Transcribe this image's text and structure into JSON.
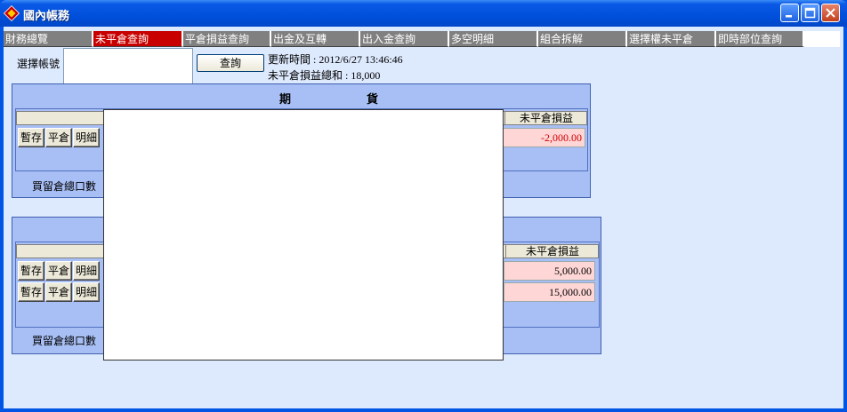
{
  "window": {
    "title": "國內帳務"
  },
  "tabs": [
    {
      "label": "財務總覽",
      "active": false
    },
    {
      "label": "未平倉查詢",
      "active": true
    },
    {
      "label": "平倉損益查詢",
      "active": false
    },
    {
      "label": "出金及互轉",
      "active": false
    },
    {
      "label": "出入金查詢",
      "active": false
    },
    {
      "label": "多空明細",
      "active": false
    },
    {
      "label": "組合拆解",
      "active": false
    },
    {
      "label": "選擇權未平倉",
      "active": false
    },
    {
      "label": "即時部位查詢",
      "active": false
    }
  ],
  "account": {
    "label": "選擇帳號",
    "value": "",
    "query_button": "查詢"
  },
  "status": {
    "updated": "更新時間 : 2012/6/27 13:46:46",
    "total_pl": "未平倉損益總和 : 18,000"
  },
  "futures_panel": {
    "title": "期　　　　　　貨",
    "pl_header": "未平倉損益",
    "row_buttons": [
      "暫存",
      "平倉",
      "明細"
    ],
    "rows": [
      {
        "pl": "-2,000.00"
      }
    ],
    "footer": "買留倉總口數"
  },
  "options_panel": {
    "pl_header": "未平倉損益",
    "row_buttons": [
      "暫存",
      "平倉",
      "明細"
    ],
    "rows": [
      {
        "pl": "5,000.00"
      },
      {
        "pl": "15,000.00"
      }
    ],
    "footer": "買留倉總口數"
  },
  "colors": {
    "active_tab": "#c80000",
    "negative": "#d00000",
    "panel": "#a8bff5"
  }
}
